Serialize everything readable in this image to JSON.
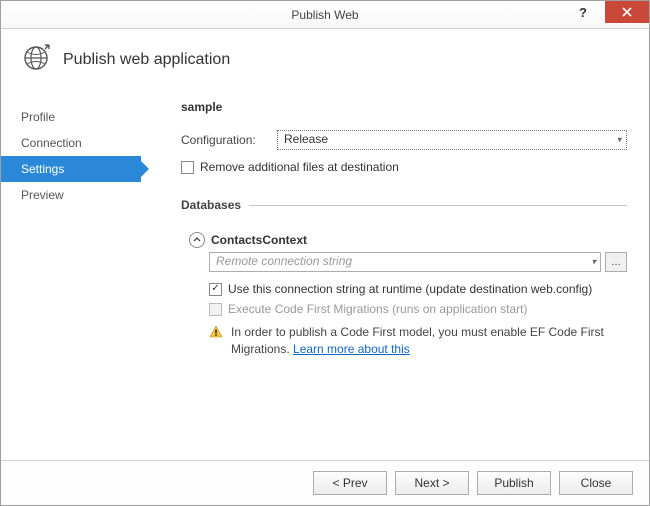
{
  "window": {
    "title": "Publish Web"
  },
  "header": {
    "title": "Publish web application"
  },
  "sidebar": {
    "items": [
      {
        "label": "Profile"
      },
      {
        "label": "Connection"
      },
      {
        "label": "Settings"
      },
      {
        "label": "Preview"
      }
    ]
  },
  "main": {
    "profile_name": "sample",
    "configuration_label": "Configuration:",
    "configuration_value": "Release",
    "remove_additional_label": "Remove additional files at destination",
    "remove_additional_checked": false,
    "databases_title": "Databases",
    "db": {
      "name": "ContactsContext",
      "conn_placeholder": "Remote connection string",
      "use_conn_label": "Use this connection string at runtime (update destination web.config)",
      "use_conn_checked": true,
      "exec_migrations_label": "Execute Code First Migrations (runs on application start)",
      "exec_migrations_checked": false,
      "warning_text": "In order to publish a Code First model, you must enable EF Code First Migrations. ",
      "warning_link": "Learn more about this"
    }
  },
  "footer": {
    "prev": "< Prev",
    "next": "Next >",
    "publish": "Publish",
    "close": "Close"
  }
}
